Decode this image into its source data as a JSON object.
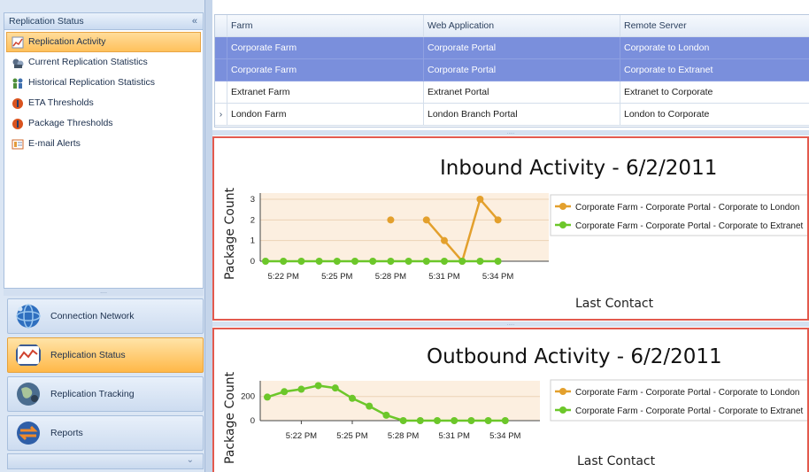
{
  "left_pane": {
    "header": "Replication Status",
    "collapse_glyph": "«",
    "splitter_grip": "....",
    "nav_items": [
      {
        "label": "Replication Activity",
        "icon": "activity-chart-icon",
        "active": true
      },
      {
        "label": "Current Replication Statistics",
        "icon": "statistics-icon",
        "active": false
      },
      {
        "label": "Historical Replication Statistics",
        "icon": "history-icon",
        "active": false
      },
      {
        "label": "ETA Thresholds",
        "icon": "threshold-icon",
        "active": false
      },
      {
        "label": "Package Thresholds",
        "icon": "package-threshold-icon",
        "active": false
      },
      {
        "label": "E-mail Alerts",
        "icon": "email-alert-icon",
        "active": false
      }
    ],
    "big_buttons": [
      {
        "label": "Connection Network",
        "icon": "globe-network-icon",
        "active": false
      },
      {
        "label": "Replication Status",
        "icon": "status-monitor-icon",
        "active": true
      },
      {
        "label": "Replication Tracking",
        "icon": "tracking-globe-icon",
        "active": false
      },
      {
        "label": "Reports",
        "icon": "reports-icon",
        "active": false
      }
    ],
    "footer_chevron": "⌄"
  },
  "grid": {
    "columns": [
      "Farm",
      "Web Application",
      "Remote Server"
    ],
    "row_indicator": "›",
    "rows": [
      {
        "farm": "Corporate Farm",
        "web_app": "Corporate Portal",
        "remote": "Corporate to London",
        "selected": true,
        "current": false
      },
      {
        "farm": "Corporate Farm",
        "web_app": "Corporate Portal",
        "remote": "Corporate to Extranet",
        "selected": true,
        "current": false
      },
      {
        "farm": "Extranet Farm",
        "web_app": "Extranet Portal",
        "remote": "Extranet to Corporate",
        "selected": false,
        "current": false
      },
      {
        "farm": "London Farm",
        "web_app": "London Branch Portal",
        "remote": "London to Corporate",
        "selected": false,
        "current": true
      }
    ],
    "splitter_grip": "....."
  },
  "colors": {
    "series_orange": "#e3a02d",
    "series_green": "#6cc72a",
    "panel_border": "#e35a4e",
    "plot_background": "#fcefe0",
    "selected_row": "#7a8fdc"
  },
  "chart_data": [
    {
      "type": "line",
      "title": "Inbound Activity - 6/2/2011",
      "xlabel": "Last Contact",
      "ylabel": "Package Count",
      "x_ticks": [
        "5:22 PM",
        "5:25 PM",
        "5:28 PM",
        "5:31 PM",
        "5:34 PM"
      ],
      "x_tick_index": [
        1,
        4,
        7,
        10,
        13
      ],
      "y_ticks": [
        0,
        1,
        2,
        3
      ],
      "ylim": [
        0,
        3.3
      ],
      "grid": true,
      "legend_position": "right",
      "series": [
        {
          "name": "Corporate Farm - Corporate Portal - Corporate to London",
          "color": "#e3a02d",
          "values": [
            null,
            null,
            null,
            null,
            null,
            null,
            null,
            2,
            null,
            2,
            1,
            0,
            3,
            2
          ]
        },
        {
          "name": "Corporate Farm - Corporate Portal - Corporate to Extranet",
          "color": "#6cc72a",
          "values": [
            0,
            0,
            0,
            0,
            0,
            0,
            0,
            0,
            0,
            0,
            0,
            0,
            0,
            0
          ]
        }
      ]
    },
    {
      "type": "line",
      "title": "Outbound Activity - 6/2/2011",
      "xlabel": "Last Contact",
      "ylabel": "Package Count",
      "x_ticks": [
        "5:22 PM",
        "5:25 PM",
        "5:28 PM",
        "5:31 PM",
        "5:34 PM"
      ],
      "x_tick_index": [
        2,
        5,
        8,
        11,
        14
      ],
      "y_ticks": [
        0,
        200
      ],
      "ylim": [
        0,
        330
      ],
      "grid": true,
      "legend_position": "right",
      "series": [
        {
          "name": "Corporate Farm - Corporate Portal - Corporate to London",
          "color": "#e3a02d",
          "values": []
        },
        {
          "name": "Corporate Farm - Corporate Portal - Corporate to Extranet",
          "color": "#6cc72a",
          "values": [
            195,
            240,
            260,
            290,
            270,
            185,
            120,
            45,
            0,
            0,
            0,
            0,
            0,
            0,
            0
          ]
        }
      ]
    }
  ]
}
